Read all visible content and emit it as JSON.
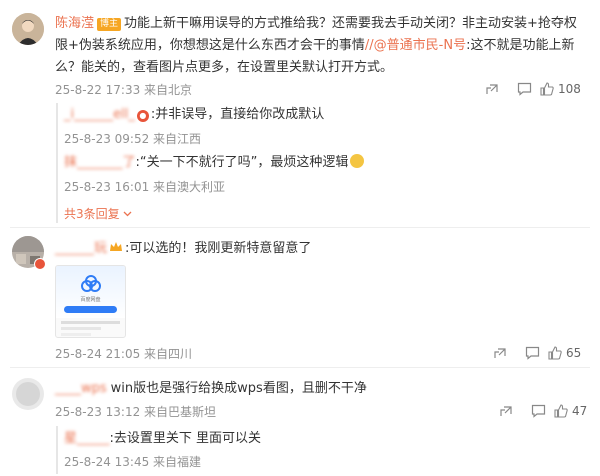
{
  "comments": [
    {
      "user": "陈海滢",
      "badge": "博主",
      "text": "功能上新干嘛用误导的方式推给我？还需要我去手动关闭？非主动安装+抢夺权限+伪装系统应用，你想想这是什么东西才会干的事情",
      "mention": "//@普通市民-N号",
      "text2": ":这不就是功能上新么？能关的，查看图片点更多，在设置里关默认打开方式。",
      "meta": "25-8-22 17:33 来自北京",
      "likes": "108",
      "replies": [
        {
          "user": "_i______ell_",
          "text": ":并非误导，直接给你改成默认",
          "meta": "25-8-23 09:52 来自江西"
        },
        {
          "user": "抹_______了",
          "text": ":“关一下不就行了吗”，最烦这种逻辑",
          "meta": "25-8-23 16:01 来自澳大利亚"
        }
      ],
      "more": "共3条回复"
    },
    {
      "user": "______玩",
      "text": ":可以选的！我刚更新特意留意了",
      "meta": "25-8-24 21:05 来自四川",
      "likes": "65",
      "image_title": "百度网盘"
    },
    {
      "user": "____wps",
      "text": "win版也是强行给换成wps看图，且删不干净",
      "meta": "25-8-23 13:12 来自巴基斯坦",
      "likes": "47",
      "replies": [
        {
          "user": "星_____",
          "text": ":去设置里关下 里面可以关",
          "meta": "25-8-24 13:45 来自福建"
        }
      ]
    }
  ],
  "icons": [
    "share-icon",
    "comment-icon",
    "like-icon"
  ],
  "colors": {
    "accent": "#eb7350",
    "meta": "#939393"
  }
}
